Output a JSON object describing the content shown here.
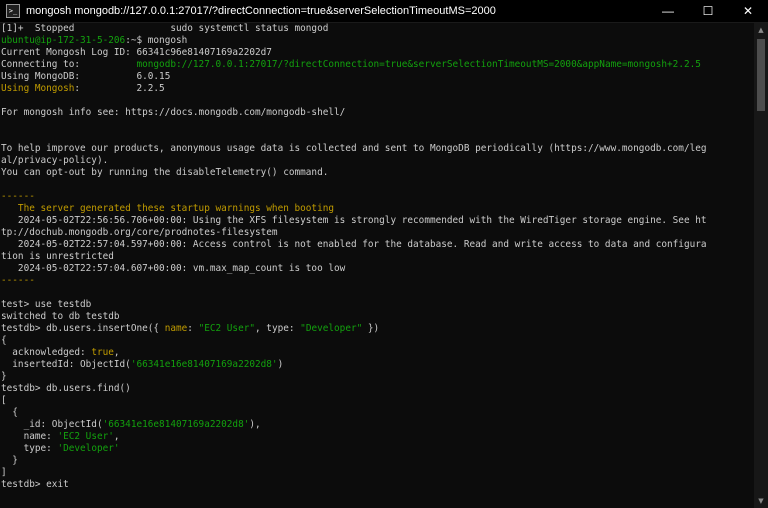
{
  "window": {
    "title": "mongosh mongodb://127.0.0.1:27017/?directConnection=true&serverSelectionTimeoutMS=2000",
    "app_icon_glyph": ">_",
    "minimize_glyph": "—",
    "maximize_glyph": "☐",
    "close_glyph": "✕"
  },
  "colors": {
    "background": "#0c0c0c",
    "text": "#cccccc",
    "green": "#13a10e",
    "yellow": "#c19c00"
  },
  "terminal": {
    "job_line": "[1]+  Stopped                 sudo systemctl status mongod",
    "prompt_user": "ubuntu@ip-172-31-5-206",
    "prompt_path": ":~$ ",
    "prompt_command": "mongosh",
    "log_id_label": "Current Mongosh Log ID: ",
    "log_id_value": "66341c96e81407169a2202d7",
    "connecting_label": "Connecting to:          ",
    "connecting_value": "mongodb://127.0.0.1:27017/?directConnection=true&serverSelectionTimeoutMS=2000&appName=mongosh+2.2.5",
    "mongodb_label": "Using MongoDB:          ",
    "mongodb_value": "6.0.15",
    "mongosh_label": "Using Mongosh",
    "mongosh_sep": ":          ",
    "mongosh_value": "2.2.5",
    "info_line": "For mongosh info see: https://docs.mongodb.com/mongodb-shell/",
    "telemetry_line1": "To help improve our products, anonymous usage data is collected and sent to MongoDB periodically (https://www.mongodb.com/leg",
    "telemetry_line2": "al/privacy-policy).",
    "telemetry_line3": "You can opt-out by running the disableTelemetry() command.",
    "dashes": "------",
    "warning_header": "   The server generated these startup warnings when booting",
    "warning1_a": "   2024-05-02T22:56:56.706+00:00: Using the XFS filesystem is strongly recommended with the WiredTiger storage engine. See ht",
    "warning1_b": "tp://dochub.mongodb.org/core/prodnotes-filesystem",
    "warning2_a": "   2024-05-02T22:57:04.597+00:00: Access control is not enabled for the database. Read and write access to data and configura",
    "warning2_b": "tion is unrestricted",
    "warning3": "   2024-05-02T22:57:04.607+00:00: vm.max_map_count is too low",
    "use_cmd": "test> use testdb",
    "switched": "switched to db testdb",
    "insert_prompt": "testdb> db.users.insertOne({ ",
    "insert_name_key": "name",
    "insert_colon1": ": ",
    "insert_name_val": "\"EC2 User\"",
    "insert_type_part": ", type: ",
    "insert_type_val": "\"Developer\"",
    "insert_close": " })",
    "open_brace": "{",
    "ack_key": "  acknowledged: ",
    "ack_val": "true",
    "ack_comma": ",",
    "inserted_key": "  insertedId: ObjectId(",
    "inserted_val": "'66341e16e81407169a2202d8'",
    "inserted_close": ")",
    "close_brace": "}",
    "find_cmd": "testdb> db.users.find()",
    "open_bracket": "[",
    "obj_open": "  {",
    "id_key": "    _id: ObjectId(",
    "id_val": "'66341e16e81407169a2202d8'",
    "id_close": "),",
    "name_key": "    name: ",
    "name_val": "'EC2 User'",
    "name_comma": ",",
    "type_key": "    type: ",
    "type_val": "'Developer'",
    "obj_close": "  }",
    "close_bracket": "]",
    "exit_cmd": "testdb> exit"
  },
  "scrollbar": {
    "up_glyph": "▲",
    "down_glyph": "▼"
  }
}
